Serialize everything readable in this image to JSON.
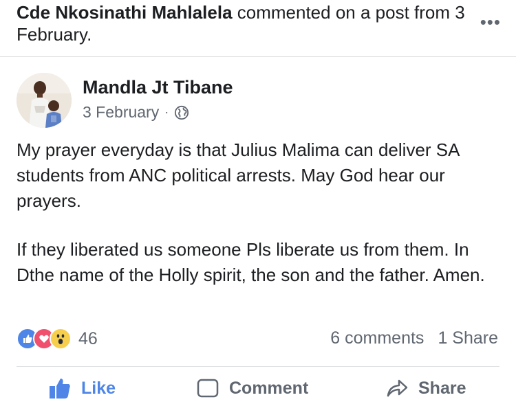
{
  "activity": {
    "actor": "Cde Nkosinathi Mahlalela",
    "action_text": " commented on a post from 3 February."
  },
  "post": {
    "author": "Mandla Jt Tibane",
    "date": "3 February",
    "separator": "·",
    "privacy_icon": "globe-icon",
    "paragraphs": [
      "My prayer everyday is that Julius Malima can deliver SA students from ANC political arrests. May God hear our prayers.",
      "If they liberated us someone Pls liberate us from them. In Dthe name of the Holly spirit, the son and the father. Amen."
    ]
  },
  "reactions": {
    "icons": [
      "like-reaction-icon",
      "love-reaction-icon",
      "wow-reaction-icon"
    ],
    "count": "46"
  },
  "stats": {
    "comments": "6 comments",
    "shares": "1 Share"
  },
  "actions": {
    "like": "Like",
    "comment": "Comment",
    "share": "Share"
  },
  "more_icon": "more-options-icon",
  "colors": {
    "like_blue": "#4e85e7",
    "love_red": "#f0506e",
    "wow_yellow": "#f7cf4d",
    "secondary_text": "#606770"
  }
}
